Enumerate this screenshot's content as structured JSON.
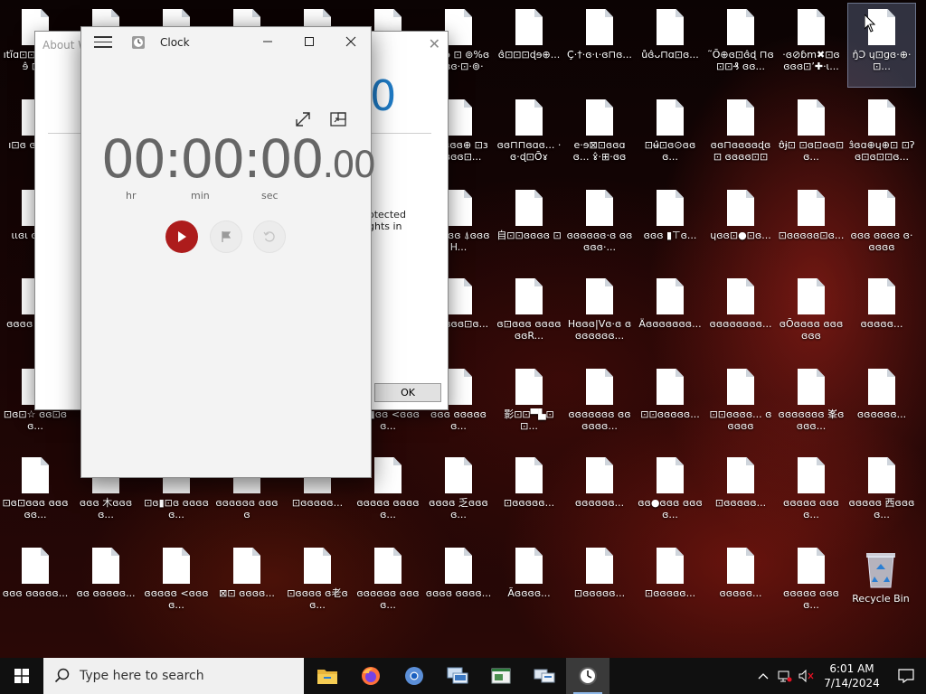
{
  "desktop": {
    "icons": [
      {
        "label": "ıtı̃ɑ⊡⊡ⓞ৫ ⍋⍋ɘ̂ ⊡⊡",
        "col": 0,
        "row": 0
      },
      {
        "label": "",
        "col": 1,
        "row": 0
      },
      {
        "label": "",
        "col": 2,
        "row": 0
      },
      {
        "label": "",
        "col": 3,
        "row": 0
      },
      {
        "label": "",
        "col": 4,
        "row": 0
      },
      {
        "label": "",
        "col": 5,
        "row": 0
      },
      {
        "label": "⊡ʔ ɘ̂ ⊡ ⊚%ɞ ʤɞɞ·⊡·⊚·⊡...",
        "col": 6,
        "row": 0
      },
      {
        "label": "ɞ̂⊡⊡⊡ɖɘ⊕...",
        "col": 7,
        "row": 0
      },
      {
        "label": "Ç̂·†·ɞ·ɩ·ɞ⊓ɞ...",
        "col": 8,
        "row": 0
      },
      {
        "label": "ůɞ̂ᴗ⊓ɑ⊡ɞ...",
        "col": 9,
        "row": 0
      },
      {
        "label": "˜Ō⊕ɞ⊡ɞ̂ɖ ⊓ɞ ⊡⊡₰ ɞɞ...",
        "col": 10,
        "row": 0
      },
      {
        "label": "·ɞ⊘ɓm✖⊡ɞ ɞɞɞ⊡ʼ✚·ɩ...",
        "col": 11,
        "row": 0
      },
      {
        "label": "ŋ̂Ɔ ɥ⊡ɡɞ·⊕·⊡...",
        "col": 12,
        "row": 0
      },
      {
        "label": "ı⊡ɞ ɞ·ⓞ·ɩɞ",
        "col": 0,
        "row": 1
      },
      {
        "label": "",
        "col": 1,
        "row": 1
      },
      {
        "label": "",
        "col": 2,
        "row": 1
      },
      {
        "label": "",
        "col": 3,
        "row": 1
      },
      {
        "label": "",
        "col": 4,
        "row": 1
      },
      {
        "label": "",
        "col": 5,
        "row": 1
      },
      {
        "label": "⍋⊡ɞɞɞ⊕ ⊡ɜ⊡ɞɞɞ⊡...",
        "col": 6,
        "row": 1
      },
      {
        "label": "ɞɞ⊓⊓ɞɑɞ... ·ɞ·ɖ⊡Ō̂ɤ",
        "col": 7,
        "row": 1
      },
      {
        "label": "e·ɘ⊠⊡ɞɞɑɞ... ɤ̂·⊞·ɞɞɞ...",
        "col": 8,
        "row": 1
      },
      {
        "label": "⊡ʉ̂⊡ɞ⊙ɞɞɞ...",
        "col": 9,
        "row": 1
      },
      {
        "label": "ɞɞ⊓ɞɞɞɞɖɞ⊡ ɞɞɞɞ⊡⊡ɑ...",
        "col": 10,
        "row": 1
      },
      {
        "label": "ʊ̂ɉ⊡ ⊡ɞ⊡ɞɞ⊡ɞ...",
        "col": 11,
        "row": 1
      },
      {
        "label": "ɜ̂ɞɑ⊕ɥ⊕⊡ ⊡ʔɞ⊡ɞ⊡⊡ɞ...",
        "col": 12,
        "row": 1
      },
      {
        "label": "ɩɩɞɩ ɞ⊡ɞɞ",
        "col": 0,
        "row": 2
      },
      {
        "label": "",
        "col": 1,
        "row": 2
      },
      {
        "label": "",
        "col": 2,
        "row": 2
      },
      {
        "label": "",
        "col": 3,
        "row": 2
      },
      {
        "label": "",
        "col": 4,
        "row": 2
      },
      {
        "label": "",
        "col": 5,
        "row": 2
      },
      {
        "label": "⍋⊓ɞɞɞ ⍋ɞɞɞH...",
        "col": 6,
        "row": 2
      },
      {
        "label": "自⊡⊡ɞɞɞɞ ⊡",
        "col": 7,
        "row": 2
      },
      {
        "label": "ɞɞɞɞɞɞ·ɞ ɞɞɞɞɞ·...",
        "col": 8,
        "row": 2
      },
      {
        "label": "ɞɞɞ ▮⊤ɞ...",
        "col": 9,
        "row": 2
      },
      {
        "label": "ɥɞɞ⊡●⊡ɞ...",
        "col": 10,
        "row": 2
      },
      {
        "label": "⊡ɞɞɞɞɞ⊡ɞ...",
        "col": 11,
        "row": 2
      },
      {
        "label": "ɞɞɞ ɞɞɞɞ ɞ·ɞɞɞɞ",
        "col": 12,
        "row": 2
      },
      {
        "label": "ɞɞɞɞ ⊡ɞɞɞ",
        "col": 0,
        "row": 3
      },
      {
        "label": "",
        "col": 1,
        "row": 3
      },
      {
        "label": "",
        "col": 2,
        "row": 3
      },
      {
        "label": "",
        "col": 3,
        "row": 3
      },
      {
        "label": "",
        "col": 4,
        "row": 3
      },
      {
        "label": "",
        "col": 5,
        "row": 3
      },
      {
        "label": "ɞ ⍋ɞɞɞ⊡ɞ...",
        "col": 6,
        "row": 3
      },
      {
        "label": "ɞ⊡ɞɞɞ ɞɞɞɞɞɞR...",
        "col": 7,
        "row": 3
      },
      {
        "label": "Hɞɞɞ|Vɞ·ɞ ɞɞɞɞɞɞɞ...",
        "col": 8,
        "row": 3
      },
      {
        "label": "Äɞɞɞɞɞɞɞ...",
        "col": 9,
        "row": 3
      },
      {
        "label": "ɞɞɞɞɞɞɞɞ...",
        "col": 10,
        "row": 3
      },
      {
        "label": "ɞŌɞɞɞɞ ɞɞɞɞɞɞ",
        "col": 11,
        "row": 3
      },
      {
        "label": "ɞɞɞɞɞ...",
        "col": 12,
        "row": 3
      },
      {
        "label": "⊡ɞ⊡☆ ɞɞ⊡ɞɞ...",
        "col": 0,
        "row": 4
      },
      {
        "label": "ɞɞ▮ɞɞ <ɞɞɞɞ...",
        "col": 5,
        "row": 4
      },
      {
        "label": "ɞɞɞ ɞɞɞɞɞɞ...",
        "col": 6,
        "row": 4
      },
      {
        "label": "影⊡⊡▀▙⊡⊡...",
        "col": 7,
        "row": 4
      },
      {
        "label": "ɞɞɞɞɞɞɞ ɞɞɞɞɞɞ...",
        "col": 8,
        "row": 4
      },
      {
        "label": "⊡⊡ɞɞɞɞɞ...",
        "col": 9,
        "row": 4
      },
      {
        "label": "⊡⊡ɞɞɞɞ... ɞɞɞɞɞ",
        "col": 10,
        "row": 4
      },
      {
        "label": "ɞɞɞɞɞɞɞ 峯ɞɞɞɞ...",
        "col": 11,
        "row": 4
      },
      {
        "label": "ɞɞɞɞɞɞ...",
        "col": 12,
        "row": 4
      },
      {
        "label": "⊡ɞ⊡ɞɞɞ ɞɞɞɞɞ...",
        "col": 0,
        "row": 5
      },
      {
        "label": "ɞɞɞ 木ɞɞɞɞ...",
        "col": 1,
        "row": 5
      },
      {
        "label": "⊡ɞ▮⊡ɞ ɞɞɞɞɞ...",
        "col": 2,
        "row": 5
      },
      {
        "label": "ɞɞɞɞɞɞ ɞɞɞɞ",
        "col": 3,
        "row": 5
      },
      {
        "label": "⊡ɞɞɞɞɞ...",
        "col": 4,
        "row": 5
      },
      {
        "label": "ɞɞɞɞɞ ɞɞɞɞɞ...",
        "col": 5,
        "row": 5
      },
      {
        "label": "ɞɞɞɞ 乏ɞɞɞɞ...",
        "col": 6,
        "row": 5
      },
      {
        "label": "⊡ɞɞɞɞɞ...",
        "col": 7,
        "row": 5
      },
      {
        "label": "ɞɞɞɞɞɞ...",
        "col": 8,
        "row": 5
      },
      {
        "label": "ɞɞ●ɞɞɞ ɞɞɞɞ...",
        "col": 9,
        "row": 5
      },
      {
        "label": "⊡ɞɞɞɞɞ...",
        "col": 10,
        "row": 5
      },
      {
        "label": "ɞɞɞɞɞ ɞɞɞɞ...",
        "col": 11,
        "row": 5
      },
      {
        "label": "ɞɞɞɞɞ 西ɞɞɞɞ...",
        "col": 12,
        "row": 5
      },
      {
        "label": "ɞɞɞ ɞɞɞɞɞ...",
        "col": 0,
        "row": 6
      },
      {
        "label": "ɞɞ ɞɞɞɞɞ...",
        "col": 1,
        "row": 6
      },
      {
        "label": "ɞɞɞɞɞ <ɞɞɞɞ...",
        "col": 2,
        "row": 6
      },
      {
        "label": "⊠⊡ ɞɞɞɞ...",
        "col": 3,
        "row": 6
      },
      {
        "label": "⊡ɞɞɞɞ ɞ老ɞɞ...",
        "col": 4,
        "row": 6
      },
      {
        "label": "ɞɞɞɞɞɞ ɞɞɞɞ...",
        "col": 5,
        "row": 6
      },
      {
        "label": "ɞɞɞɞ ɞɞɞɞ...",
        "col": 6,
        "row": 6
      },
      {
        "label": "Ãɞɞɞɞ...",
        "col": 7,
        "row": 6
      },
      {
        "label": "⊡ɞɞɞɞɞ...",
        "col": 8,
        "row": 6
      },
      {
        "label": "⊡ɞɞɞɞɞ...",
        "col": 9,
        "row": 6
      },
      {
        "label": "ɞɞɞɞɞ...",
        "col": 10,
        "row": 6
      },
      {
        "label": "ɞɞɞɞɞ ɞɞɞɞ...",
        "col": 11,
        "row": 6
      }
    ],
    "recycle_bin_label": "Recycle Bin"
  },
  "about_window": {
    "title": "About W",
    "close": "✕",
    "logo_fragment": "0",
    "text_line1": "otected",
    "text_line2": "ghts in",
    "ok_label": "OK"
  },
  "clock_window": {
    "title": "Clock",
    "minimize": "—",
    "maximize": "☐",
    "close": "✕",
    "stopwatch": {
      "main": "00:00:00",
      "fraction": ".00",
      "unit_hr": "hr",
      "unit_min": "min",
      "unit_sec": "sec"
    }
  },
  "taskbar": {
    "search_placeholder": "Type here to search",
    "time": "6:01 AM",
    "date": "7/14/2024"
  },
  "colors": {
    "accent": "#ad1c1c",
    "taskbar": "#101010",
    "window_bg": "#f3f3f3"
  }
}
